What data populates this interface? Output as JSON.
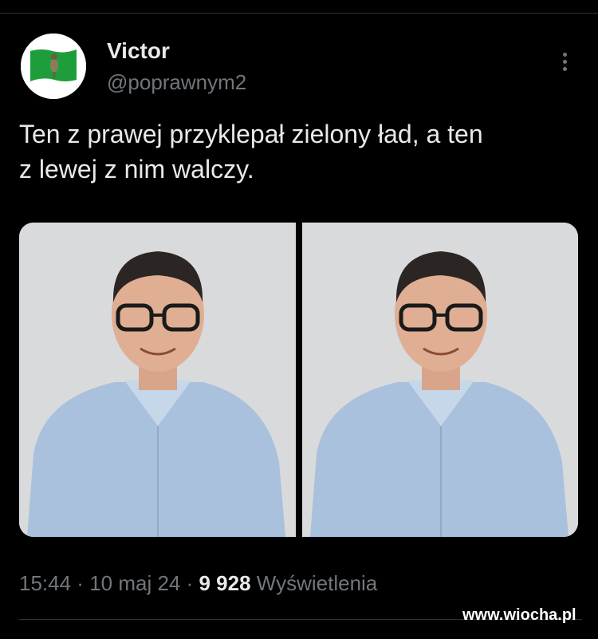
{
  "author": {
    "name": "Victor",
    "handle": "@poprawnym2",
    "avatar_icon": "green-flag-ostrich-icon"
  },
  "tweet": {
    "text_line1": "Ten z prawej przyklepał zielony ład, a ten",
    "text_line2": "z lewej z nim walczy."
  },
  "media": {
    "count": 2,
    "background_color": "#d9dadc"
  },
  "meta": {
    "time": "15:44",
    "sep1": " · ",
    "date": "10 maj 24",
    "sep2": " · ",
    "views_count": "9 928",
    "views_label": " Wyświetlenia"
  },
  "watermark": "www.wiocha.pl",
  "colors": {
    "background": "#000000",
    "text": "#e7e9ea",
    "secondary": "#71767b",
    "flag_green": "#1e9e3a"
  }
}
